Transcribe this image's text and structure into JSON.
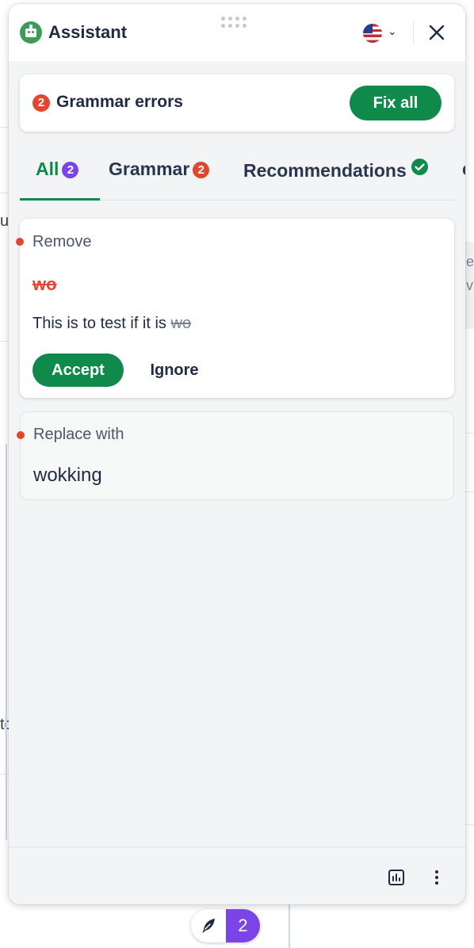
{
  "header": {
    "title": "Assistant",
    "language_icon": "us-flag-icon",
    "close_icon": "close-icon"
  },
  "summary": {
    "error_count": "2",
    "text": "Grammar errors",
    "fix_all_label": "Fix all"
  },
  "tabs": [
    {
      "label": "All",
      "badge": "2",
      "active": true
    },
    {
      "label": "Grammar",
      "badge": "2",
      "active": false
    },
    {
      "label": "Recommendations",
      "badge_icon": "check-circle-icon",
      "active": false
    }
  ],
  "cards": [
    {
      "label": "Remove",
      "word": "wo",
      "context_text": "This is to test if it is",
      "context_deleted": "wo",
      "accept_label": "Accept",
      "ignore_label": "Ignore"
    },
    {
      "label": "Replace with",
      "replacement": "wokking"
    }
  ],
  "footer": {
    "stats_icon": "stats-icon",
    "more_icon": "more-vertical-icon"
  },
  "floating_button": {
    "icon": "quill-icon",
    "count": "2"
  },
  "colors": {
    "accent_green": "#0f8a4a",
    "error_red": "#e2462f",
    "badge_purple": "#7a44e8"
  }
}
